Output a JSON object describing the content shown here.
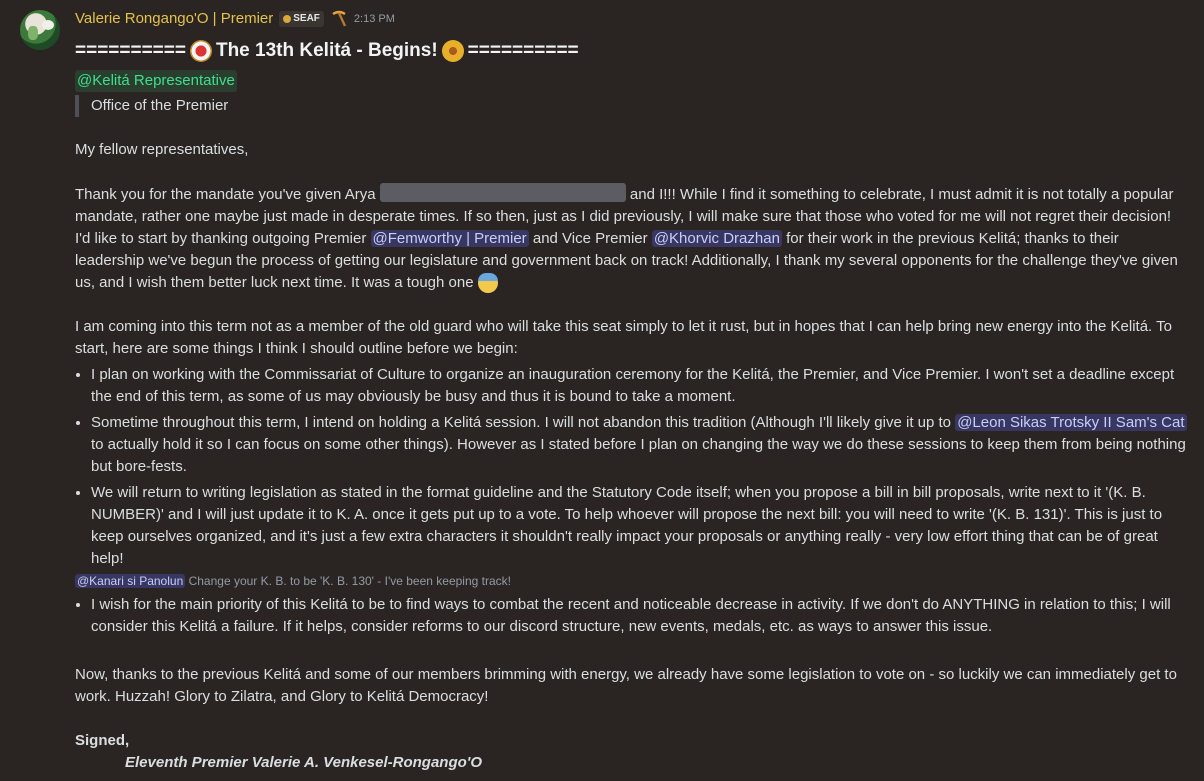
{
  "message": {
    "author": "Valerie Rongango'O | Premier",
    "tag": "SEAF",
    "timestamp": "2:13 PM",
    "title": "========== ⭐ The 13th Kelitá - Begins! 🌞 ==========",
    "title_left": "==========",
    "title_text": "The 13th Kelitá - Begins!",
    "title_right": "==========",
    "role_mention": "@Kelitá Representative",
    "quote": "Office of the Premier",
    "greeting": "My fellow representatives,",
    "p1_a": "Thank you for the mandate you've given Arya",
    "p1_b": "and I!!! While I find it something to celebrate, I must admit it is not totally a popular mandate, rather one maybe just made in desperate times. If so then, just as I did previously, I will make sure that those who voted for me will not regret their decision! I'd like to start by thanking outgoing Premier",
    "mention_1": "@Femworthy | Premier",
    "p1_c": "and Vice Premier",
    "mention_2": "@Khorvic Drazhan",
    "p1_d": "for their work in the previous Kelitá; thanks to their leadership we've begun the process of getting our legislature and government back on track! Additionally, I thank my several opponents for the challenge they've given us, and I wish them better luck next time. It was a tough one",
    "p2": "I am coming into this term not as a member of the old guard who will take this seat simply to let it rust, but in hopes that I can help bring new energy into the Kelitá. To start, here are some things I think I should outline before we begin:",
    "bullet_1": "I plan on working with the Commissariat of Culture to organize an inauguration ceremony for the Kelitá, the Premier, and Vice Premier. I won't set a deadline except the end of this term, as some of us may obviously be busy and thus it is bound to take a moment.",
    "bullet_2_a": "Sometime throughout this term, I intend on holding a Kelitá session. I will not abandon this tradition (Although I'll likely give it up to",
    "mention_3": "@Leon Sikas Trotsky II Sam's Cat",
    "bullet_2_b": "to actually hold it so I can focus on some other things). However as I stated before I plan on changing the way we do these sessions to keep them from being nothing but bore-fests.",
    "bullet_3": "We will return to writing legislation as stated in the format guideline and the Statutory Code itself; when you propose a bill in bill proposals, write next to it '(K. B. NUMBER)' and I will just update it to K. A. once it gets put up to a vote. To help whoever will propose the next bill: you will need to write '(K. B. 131)'. This is just to keep ourselves organized, and it's just a few extra characters it shouldn't really impact your proposals or anything really - very low effort thing that can be of great help!",
    "reply_mention": "@Kanari si Panolun",
    "reply_text": "Change your K. B. to be 'K. B. 130' - I've been keeping track!",
    "bullet_4": "I wish for the main priority of this Kelitá to be to find ways to combat the recent and noticeable decrease in activity. If we don't do ANYTHING in relation to this; I will consider this Kelitá a failure. If it helps, consider reforms to our discord structure, new events, medals, etc. as ways to answer this issue.",
    "p3": "Now, thanks to the previous Kelitá and some of our members brimming with energy, we already have some legislation to vote on - so luckily we can immediately get to work. Huzzah! Glory to Zilatra, and Glory to Kelitá Democracy!",
    "signed": "Signed,",
    "signature": "Eleventh Premier Valerie A. Venkesel-Rongango'O"
  },
  "colors": {
    "background": "#2a2523",
    "username": "#e5c24a",
    "role_mention": "#3ee08c",
    "user_mention_bg": "#5865f2"
  }
}
